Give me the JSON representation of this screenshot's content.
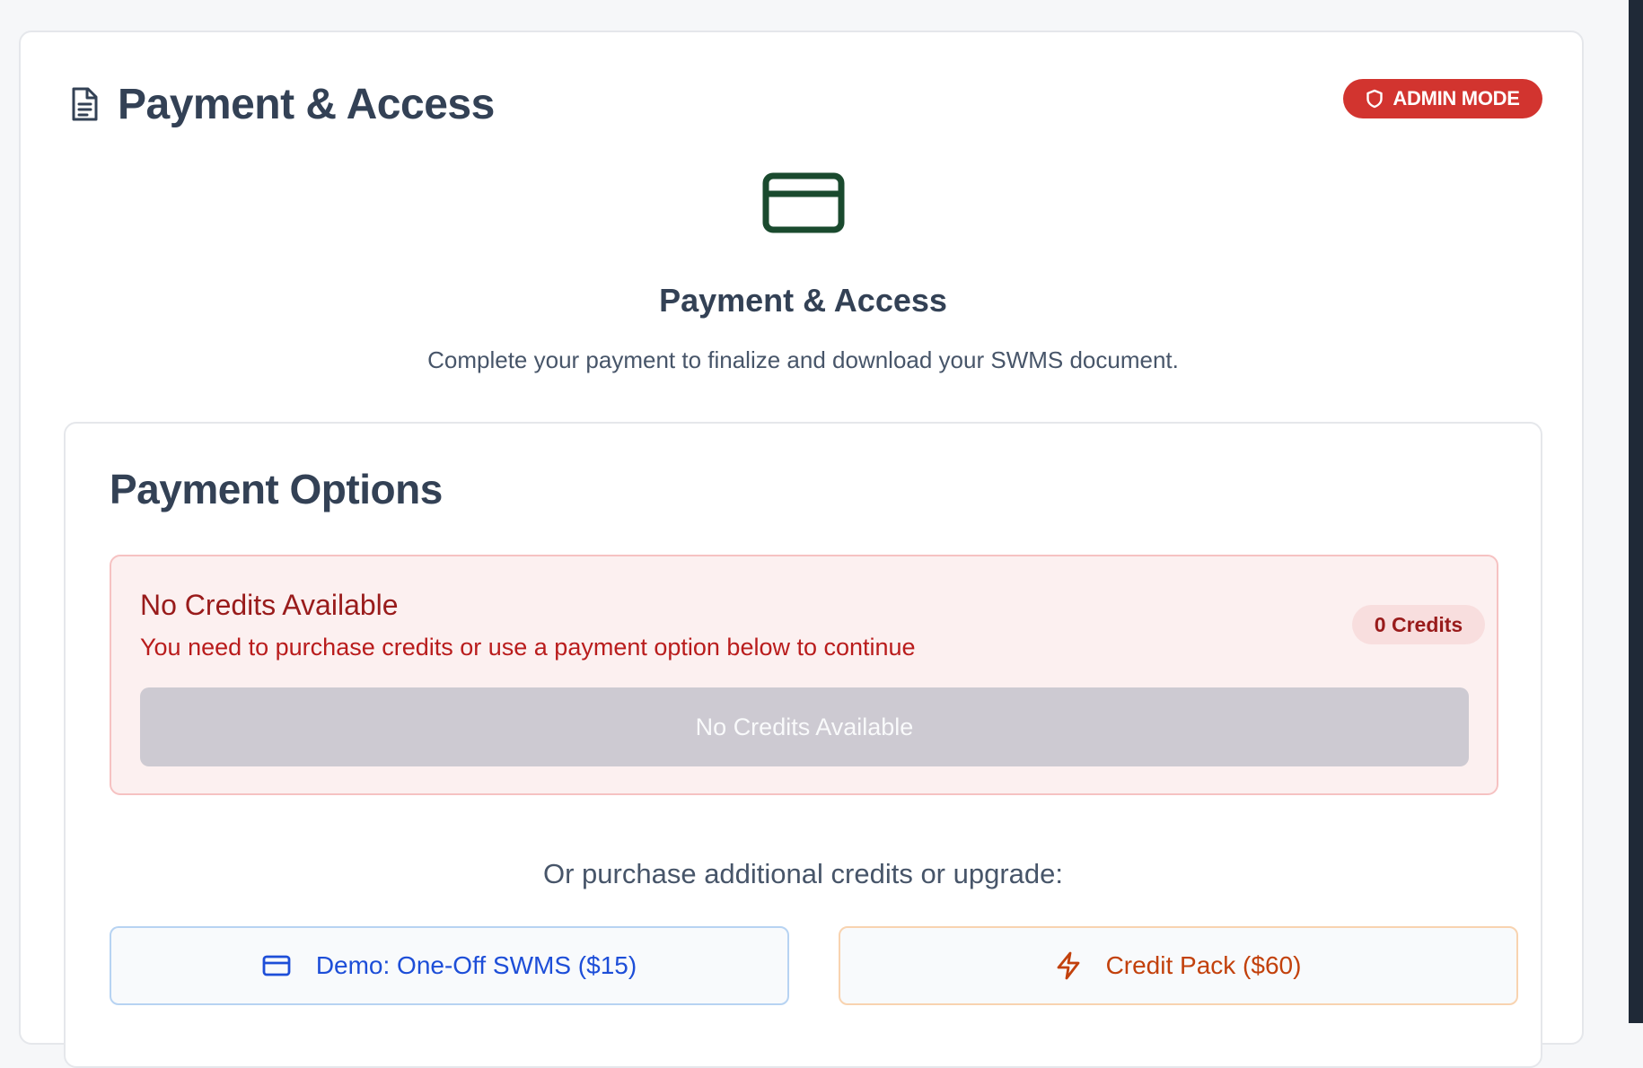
{
  "header": {
    "title": "Payment & Access",
    "badge": "ADMIN MODE"
  },
  "hero": {
    "icon": "credit-card-icon",
    "title": "Payment & Access",
    "subtitle": "Complete your payment to finalize and download your SWMS document."
  },
  "payment_options": {
    "title": "Payment Options",
    "alert": {
      "title": "No Credits Available",
      "description": "You need to purchase credits or use a payment option below to continue",
      "credits_badge": "0 Credits",
      "button_label": "No Credits Available"
    },
    "purchase_prompt": "Or purchase additional credits or upgrade:",
    "plans": [
      {
        "label": "Demo: One-Off SWMS ($15)",
        "icon": "credit-card-icon"
      },
      {
        "label": "Credit Pack ($60)",
        "icon": "lightning-icon"
      }
    ]
  },
  "colors": {
    "admin_badge": "#d2342f",
    "hero_icon": "#1a4a2e",
    "alert_bg": "#fcf0f0",
    "alert_text": "#991b1b",
    "demo_accent": "#1d4ed8",
    "credit_accent": "#c2410c"
  }
}
